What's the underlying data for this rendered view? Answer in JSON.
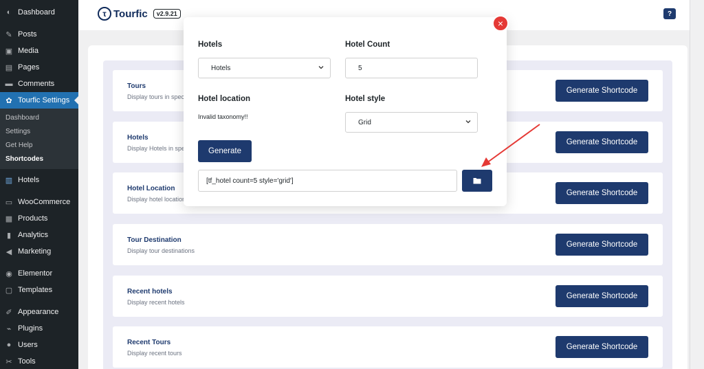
{
  "sidebar": {
    "items": [
      {
        "label": "Dashboard",
        "icon": "dashboard-icon"
      },
      {
        "label": "Posts",
        "icon": "pin-icon"
      },
      {
        "label": "Media",
        "icon": "media-icon"
      },
      {
        "label": "Pages",
        "icon": "pages-icon"
      },
      {
        "label": "Comments",
        "icon": "comment-icon"
      },
      {
        "label": "Tourfic Settings",
        "icon": "tourfic-icon"
      }
    ],
    "submenu": [
      "Dashboard",
      "Settings",
      "Get Help",
      "Shortcodes"
    ],
    "items2": [
      {
        "label": "Hotels",
        "icon": "hotel-icon"
      },
      {
        "label": "WooCommerce",
        "icon": "woo-icon"
      },
      {
        "label": "Products",
        "icon": "products-icon"
      },
      {
        "label": "Analytics",
        "icon": "analytics-icon"
      },
      {
        "label": "Marketing",
        "icon": "megaphone-icon"
      },
      {
        "label": "Elementor",
        "icon": "elementor-icon"
      },
      {
        "label": "Templates",
        "icon": "templates-icon"
      },
      {
        "label": "Appearance",
        "icon": "brush-icon"
      },
      {
        "label": "Plugins",
        "icon": "plugin-icon"
      },
      {
        "label": "Users",
        "icon": "users-icon"
      },
      {
        "label": "Tools",
        "icon": "wrench-icon"
      }
    ]
  },
  "header": {
    "logo_text": "Tourfic",
    "version": "v2.9.21",
    "help": "?"
  },
  "cards": [
    {
      "title": "Tours",
      "desc": "Display tours in specific...",
      "button": "Generate Shortcode"
    },
    {
      "title": "Hotels",
      "desc": "Display Hotels in specific...",
      "button": "Generate Shortcode"
    },
    {
      "title": "Hotel Location",
      "desc": "Display hotel locations",
      "button": "Generate Shortcode"
    },
    {
      "title": "Tour Destination",
      "desc": "Display tour destinations",
      "button": "Generate Shortcode"
    },
    {
      "title": "Recent hotels",
      "desc": "Display recent hotels",
      "button": "Generate Shortcode"
    },
    {
      "title": "Recent Tours",
      "desc": "Display recent tours",
      "button": "Generate Shortcode"
    }
  ],
  "modal": {
    "hotels_label": "Hotels",
    "hotels_value": "Hotels",
    "count_label": "Hotel Count",
    "count_value": "5",
    "location_label": "Hotel location",
    "invalid": "Invalid taxonomy!!",
    "style_label": "Hotel style",
    "style_value": "Grid",
    "generate": "Generate",
    "shortcode": "[tf_hotel count=5 style='grid']",
    "close": "×"
  },
  "colors": {
    "accent": "#1e3a6e",
    "wp_blue": "#2271b1",
    "close_red": "#e53935",
    "arrow_red": "#e53935"
  }
}
